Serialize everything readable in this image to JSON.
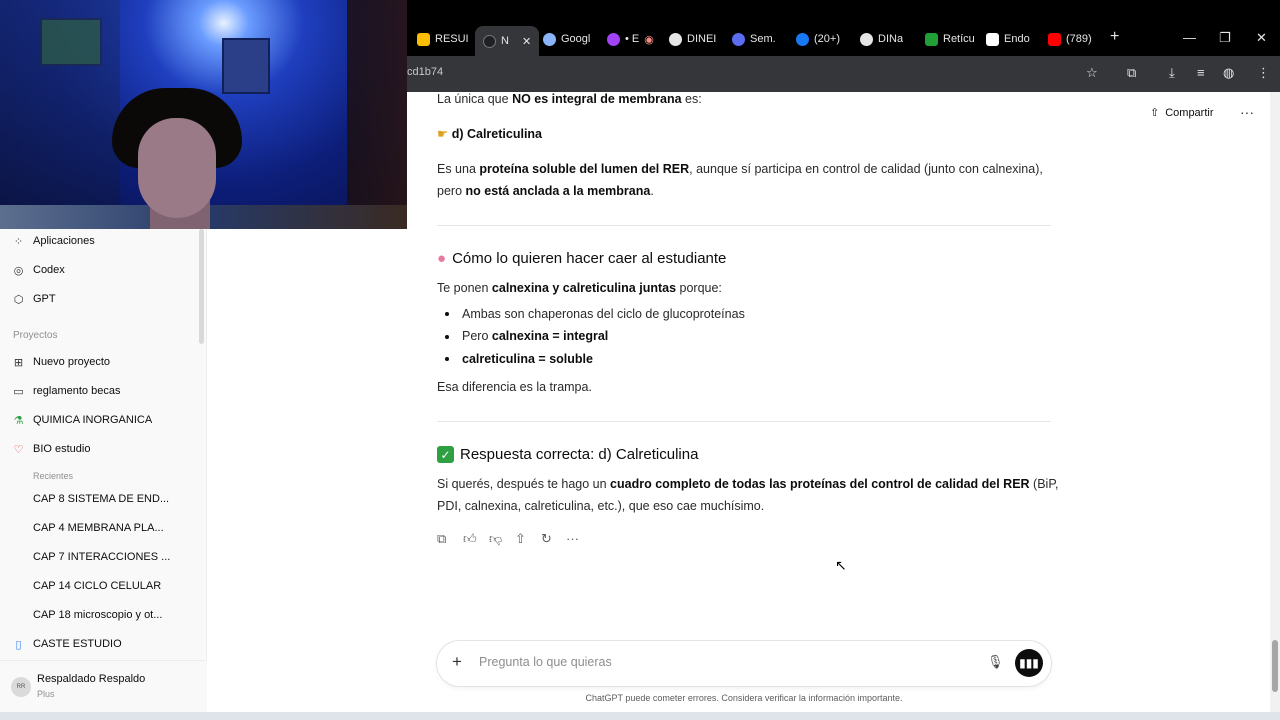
{
  "browser": {
    "tabs": [
      {
        "label": "RESUI",
        "color": "#fbbc04"
      },
      {
        "label": "N",
        "color": "#202124",
        "active": true
      },
      {
        "label": "Googl",
        "color": "#8ab4f8"
      },
      {
        "label": "• E",
        "color": "#a142f4"
      },
      {
        "label": "DINEI",
        "color": "#e6e6e6"
      },
      {
        "label": "Sem.",
        "color": "#5b6cf0"
      },
      {
        "label": "(20+)",
        "color": "#1877f2"
      },
      {
        "label": "DINa",
        "color": "#e6e6e6"
      },
      {
        "label": "Retícu",
        "color": "#21a038"
      },
      {
        "label": "Endo",
        "color": "#ffffff"
      },
      {
        "label": "(789)",
        "color": "#ff0000"
      }
    ],
    "url_fragment": "cd1b74"
  },
  "sidebar": {
    "items": [
      {
        "label": "Aplicaciones",
        "icon": "grid-icon"
      },
      {
        "label": "Codex",
        "icon": "codex-icon"
      },
      {
        "label": "GPT",
        "icon": "cube-icon"
      }
    ],
    "projects_label": "Proyectos",
    "projects": [
      {
        "label": "Nuevo proyecto",
        "icon": "folder-plus-icon"
      },
      {
        "label": "reglamento becas",
        "icon": "folder-icon"
      },
      {
        "label": "QUIMICA INORGANICA",
        "icon": "flask-icon"
      },
      {
        "label": "BIO estudio",
        "icon": "heart-icon"
      }
    ],
    "recents_label": "Recientes",
    "recents": [
      "CAP 8 SISTEMA DE END...",
      "CAP 4 MEMBRANA PLA...",
      "CAP 7 INTERACCIONES ...",
      "CAP 14 CICLO CELULAR",
      "CAP 18 microscopio y ot..."
    ],
    "extra_project": {
      "label": "CASTE ESTUDIO",
      "icon": "book-icon"
    },
    "user": {
      "initials": "RR",
      "name": "Respaldado Respaldo",
      "plan": "Plus"
    }
  },
  "header": {
    "share_label": "Compartir"
  },
  "chat": {
    "intro_pre": "La única que ",
    "intro_bold": "NO es integral de membrana",
    "intro_post": " es:",
    "answer_line": "d) Calreticulina",
    "p1_a": "Es una ",
    "p1_b": "proteína soluble del lumen del RER",
    "p1_c": ", aunque sí participa en control de calidad (junto con calnexina),",
    "p2_a": "pero ",
    "p2_b": "no está anclada a la membrana",
    "p2_c": ".",
    "h_trap": "Cómo lo quieren hacer caer al estudiante",
    "trap_a": "Te ponen ",
    "trap_b": "calnexina y calreticulina juntas",
    "trap_c": " porque:",
    "b1": "Ambas son chaperonas del ciclo de glucoproteínas",
    "b2_a": "Pero ",
    "b2_b": "calnexina = integral",
    "b3": "calreticulina = soluble",
    "trap_end": "Esa diferencia es la trampa.",
    "h_correct": "Respuesta correcta: d) Calreticulina",
    "final_a": "Si querés, después te hago un ",
    "final_b": "cuadro completo de todas las proteínas del control de calidad del RER",
    "final_c": " (BiP,",
    "final_d": "PDI, calnexina, calreticulina, etc.), que eso cae muchísimo."
  },
  "composer": {
    "placeholder": "Pregunta lo que quieras",
    "disclaimer": "ChatGPT puede cometer errores. Considera verificar la información importante."
  }
}
